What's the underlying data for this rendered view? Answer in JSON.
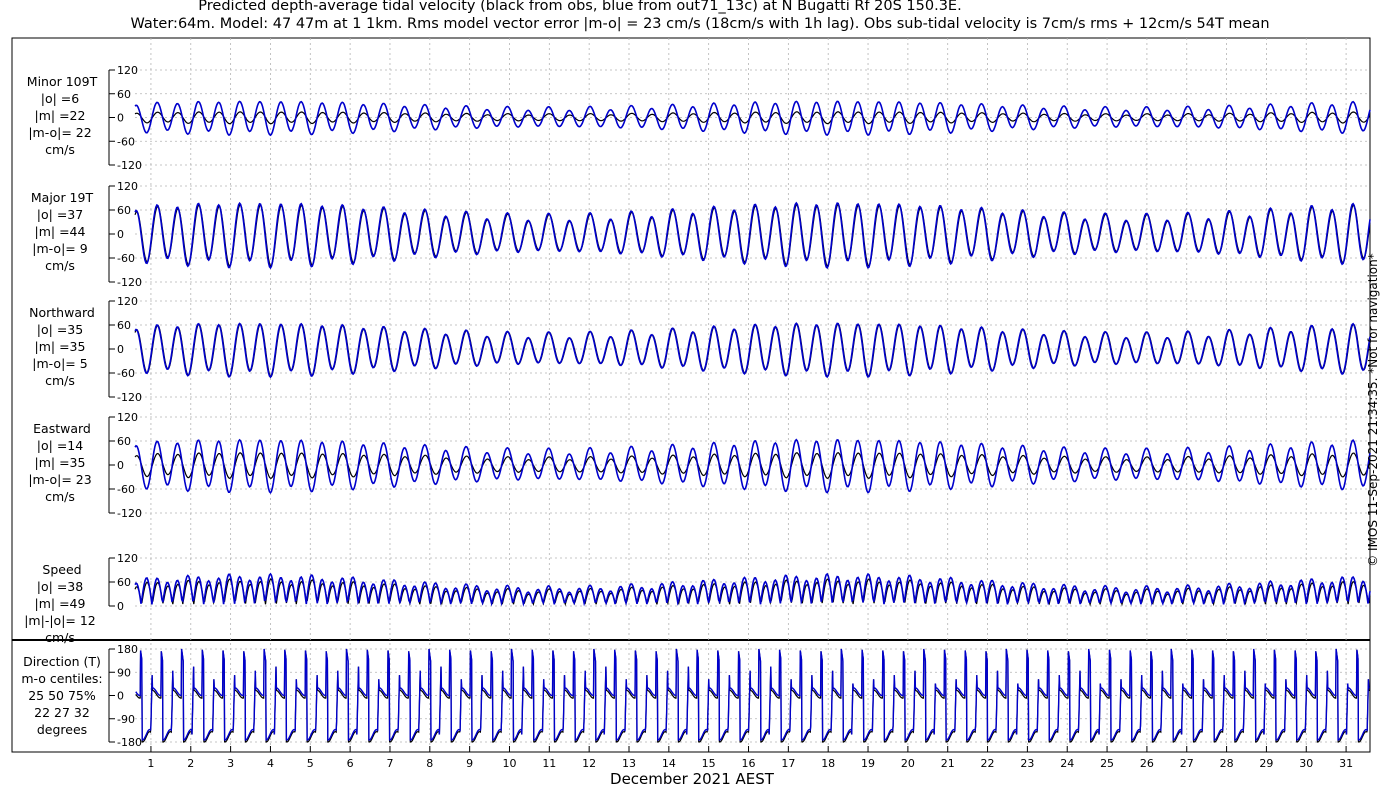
{
  "title_line1": "Predicted depth-average tidal velocity (black from obs, blue from out71_13c) at N Bugatti Rf 20S 150.3E.",
  "title_line2": "Water:64m. Model: 47 47m at 1 1km. Rms model vector error |m-o| = 23 cm/s (18cm/s with 1h lag). Obs sub-tidal velocity is 7cm/s rms + 12cm/s 54T mean",
  "copyright": "© IMOS 11-Sep-2021 21:34:35. *Not for navigation*",
  "colors": {
    "obs": "#000000",
    "model": "#0000cc",
    "grid": "#b4b4b4"
  },
  "chart_data": {
    "type": "line",
    "xlabel": "December 2021 AEST",
    "x_ticks": [
      "1",
      "2",
      "3",
      "4",
      "5",
      "6",
      "7",
      "8",
      "9",
      "10",
      "11",
      "12",
      "13",
      "14",
      "15",
      "16",
      "17",
      "18",
      "19",
      "20",
      "21",
      "22",
      "23",
      "24",
      "25",
      "26",
      "27",
      "28",
      "29",
      "30",
      "31"
    ],
    "xlim": [
      0.6,
      31.6
    ],
    "series_names": [
      "obs",
      "model"
    ],
    "grid": true,
    "panels": [
      {
        "id": "minor",
        "label": [
          "Minor 109T",
          "|o| =6",
          "|m| =22",
          "|m-o|= 22",
          "cm/s"
        ],
        "ylim": [
          -120,
          120
        ],
        "yticks": [
          "120",
          "60",
          "0",
          "-60",
          "-120"
        ],
        "obs_amplitude": 14,
        "model_amplitude": 40
      },
      {
        "id": "major",
        "label": [
          "Major 19T",
          "|o| =37",
          "|m| =44",
          "|m-o|= 9",
          "cm/s"
        ],
        "ylim": [
          -120,
          120
        ],
        "yticks": [
          "120",
          "60",
          "0",
          "-60",
          "-120"
        ],
        "obs_amplitude": 72,
        "model_amplitude": 76
      },
      {
        "id": "northward",
        "label": [
          "Northward",
          "|o| =35",
          "|m| =35",
          "|m-o|= 5",
          "cm/s"
        ],
        "ylim": [
          -120,
          120
        ],
        "yticks": [
          "120",
          "60",
          "0",
          "-60",
          "-120"
        ],
        "obs_amplitude": 62,
        "model_amplitude": 63
      },
      {
        "id": "eastward",
        "label": [
          "Eastward",
          "|o| =14",
          "|m| =35",
          "|m-o|= 23",
          "cm/s"
        ],
        "ylim": [
          -120,
          120
        ],
        "yticks": [
          "120",
          "60",
          "0",
          "-60",
          "-120"
        ],
        "obs_amplitude": 30,
        "model_amplitude": 62
      },
      {
        "id": "speed",
        "label": [
          "Speed",
          "|o| =38",
          "|m| =49",
          "|m|-|o|= 12",
          "cm/s"
        ],
        "ylim": [
          0,
          120
        ],
        "yticks": [
          "120",
          "60",
          "0"
        ],
        "obs_amplitude": 60,
        "model_amplitude": 72
      },
      {
        "id": "direction",
        "label": [
          "Direction (T)",
          "m-o centiles:",
          "25  50  75%",
          "22  27  32",
          "degrees"
        ],
        "ylim": [
          -180,
          180
        ],
        "yticks": [
          "180",
          "90",
          "0",
          "-90",
          "-180"
        ]
      }
    ]
  }
}
